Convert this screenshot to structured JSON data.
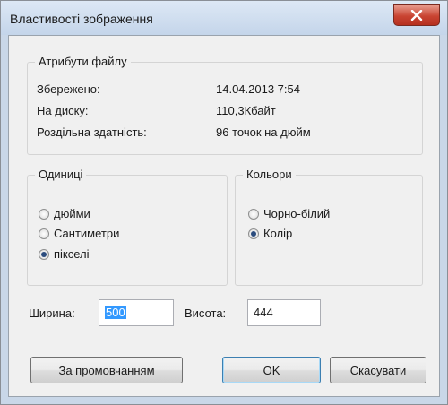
{
  "window": {
    "title": "Властивості зображення"
  },
  "attributes": {
    "legend": "Атрибути файлу",
    "rows": [
      {
        "key": "Збережено:",
        "value": "14.04.2013 7:54"
      },
      {
        "key": "На диску:",
        "value": "110,3Кбайт"
      },
      {
        "key": "Роздільна здатність:",
        "value": "96 точок на дюйм"
      }
    ]
  },
  "units": {
    "legend": "Одиниці",
    "options": [
      {
        "label": "дюйми",
        "selected": false
      },
      {
        "label": "Сантиметри",
        "selected": false
      },
      {
        "label": "пікселі",
        "selected": true
      }
    ]
  },
  "colors": {
    "legend": "Кольори",
    "options": [
      {
        "label": "Чорно-білий",
        "selected": false
      },
      {
        "label": "Колір",
        "selected": true
      }
    ]
  },
  "size": {
    "width_label": "Ширина:",
    "width_value": "500",
    "height_label": "Висота:",
    "height_value": "444"
  },
  "buttons": {
    "default": "За промовчанням",
    "ok": "OK",
    "cancel": "Скасувати"
  }
}
